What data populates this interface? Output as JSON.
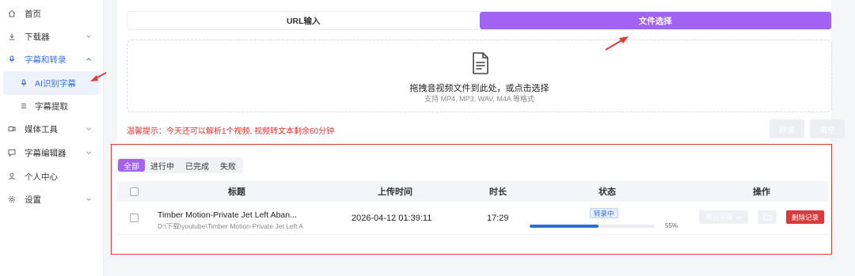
{
  "sidebar": {
    "items": [
      {
        "label": "首页",
        "icon": "home-icon"
      },
      {
        "label": "下载器",
        "icon": "download-icon"
      },
      {
        "label": "字幕和转录",
        "icon": "mic-icon"
      },
      {
        "label": "AI识别字幕",
        "icon": "mic-icon"
      },
      {
        "label": "字幕提取",
        "icon": "list-icon"
      },
      {
        "label": "媒体工具",
        "icon": "video-icon"
      },
      {
        "label": "字幕编辑器",
        "icon": "chat-icon"
      },
      {
        "label": "个人中心",
        "icon": "user-icon"
      },
      {
        "label": "设置",
        "icon": "gear-icon"
      }
    ]
  },
  "source_tabs": {
    "url": "URL输入",
    "file": "文件选择"
  },
  "dropzone": {
    "title": "拖拽音视频文件到此处，或点击选择",
    "formats": "支持 MP4, MP3, WAV, M4A 等格式"
  },
  "hint": "温馨提示：今天还可以解析1个视频, 视频转文本剩余60分钟",
  "actions": {
    "transcribe": "转录",
    "clear": "清空"
  },
  "filters": [
    "全部",
    "进行中",
    "已完成",
    "失败"
  ],
  "table": {
    "headers": {
      "title": "标题",
      "upload_time": "上传时间",
      "duration": "时长",
      "status": "状态",
      "ops": "操作"
    },
    "rows": [
      {
        "title": "Timber Motion-Private Jet Left Aban...",
        "path": "D:\\下载\\youtube\\Timber Motion-Private Jet Left A",
        "upload_time": "2026-04-12 01:39:11",
        "duration": "17:29",
        "status": "转录中",
        "progress": 0.55,
        "progress_label": "55%",
        "export_label": "导出字幕",
        "delete_label": "删除记录"
      }
    ]
  },
  "colors": {
    "accent": "#a262f3",
    "link": "#3a6fe0",
    "danger": "#d93a3a",
    "annotation": "#e03a3a"
  }
}
